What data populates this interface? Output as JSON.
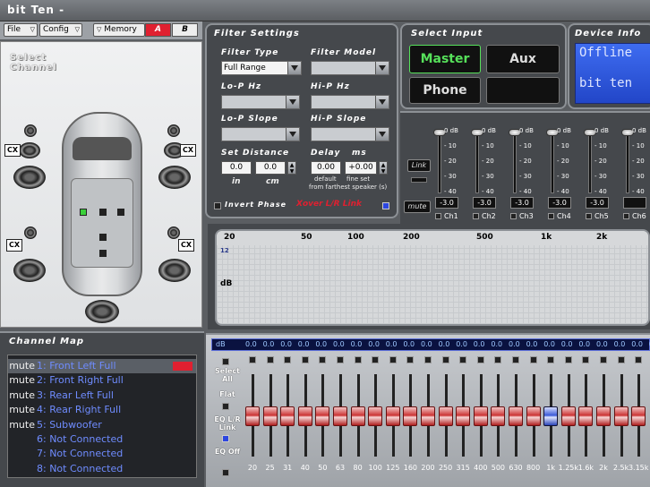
{
  "app": {
    "title": "bit Ten -"
  },
  "toolbar": {
    "file": "File",
    "config": "Config",
    "memory": "Memory",
    "mem_a": "A",
    "mem_b": "B"
  },
  "select_channel": {
    "title_line1": "Select",
    "title_line2": "Channel",
    "cx": "CX"
  },
  "filter": {
    "title": "Filter Settings",
    "type_label": "Filter Type",
    "type_value": "Full Range",
    "model_label": "Filter Model",
    "lop_label": "Lo-P  Hz",
    "hip_label": "Hi-P  Hz",
    "lop_slope_label": "Lo-P Slope",
    "hip_slope_label": "Hi-P Slope",
    "distance_label": "Set Distance",
    "dist_in": "0.0",
    "dist_cm": "0.0",
    "in_label": "in",
    "cm_label": "cm",
    "delay_label": "Delay",
    "ms_label": "ms",
    "delay_default": "0.00",
    "delay_fine": "+0.00",
    "default_label": "default",
    "fine_label": "fine set",
    "note": "from farthest speaker (s)",
    "invert_label": "Invert Phase",
    "xover_label": "Xover L/R Link"
  },
  "select_input": {
    "title": "Select Input",
    "master": "Master",
    "aux": "Aux",
    "phone": "Phone"
  },
  "device_info": {
    "title": "Device Info",
    "line1": "Offline",
    "line2": "bit ten"
  },
  "mixer": {
    "link": "Link",
    "mute": "mute",
    "scale": [
      "0 dB",
      "- 10",
      "- 20",
      "- 30",
      "- 40"
    ],
    "channels": [
      {
        "value": "-3.0",
        "label": "Ch1"
      },
      {
        "value": "-3.0",
        "label": "Ch2"
      },
      {
        "value": "-3.0",
        "label": "Ch3"
      },
      {
        "value": "-3.0",
        "label": "Ch4"
      },
      {
        "value": "-3.0",
        "label": "Ch5"
      },
      {
        "value": "",
        "label": "Ch6"
      }
    ]
  },
  "graph": {
    "freq_labels": [
      "20",
      "50",
      "100",
      "200",
      "500",
      "1k",
      "2k"
    ],
    "y_top": "12",
    "y_label": "dB"
  },
  "channel_map": {
    "title": "Channel Map",
    "rows": [
      {
        "mute": "mute",
        "text": "1: Front Left Full"
      },
      {
        "mute": "mute",
        "text": "2: Front Right Full"
      },
      {
        "mute": "mute",
        "text": "3: Rear Left Full"
      },
      {
        "mute": "mute",
        "text": "4: Rear Right Full"
      },
      {
        "mute": "mute",
        "text": "5: Subwoofer"
      },
      {
        "mute": "",
        "text": "6: Not Connected"
      },
      {
        "mute": "",
        "text": "7: Not Connected"
      },
      {
        "mute": "",
        "text": "8: Not Connected"
      }
    ]
  },
  "eq": {
    "db_label": "dB",
    "values": [
      "0.0",
      "0.0",
      "0.0",
      "0.0",
      "0.0",
      "0.0",
      "0.0",
      "0.0",
      "0.0",
      "0.0",
      "0.0",
      "0.0",
      "0.0",
      "0.0",
      "0.0",
      "0.0",
      "0.0",
      "0.0",
      "0.0",
      "0.0",
      "0.0",
      "0.0",
      "0.0",
      "0.0"
    ],
    "select_all": "Select All",
    "flat": "Flat",
    "eq_lr_link": "EQ L/R Link",
    "eq_off": "EQ Off",
    "bands": [
      "20",
      "25",
      "31",
      "40",
      "50",
      "63",
      "80",
      "100",
      "125",
      "160",
      "200",
      "250",
      "315",
      "400",
      "500",
      "630",
      "800",
      "1k",
      "1.25k",
      "1.6k",
      "2k",
      "2.5k",
      "3.15k"
    ]
  },
  "colors": {
    "accent_green": "#56e05a",
    "accent_red": "#e02030",
    "link_blue": "#5f7cff",
    "eq_value": "#9ec8ff"
  }
}
